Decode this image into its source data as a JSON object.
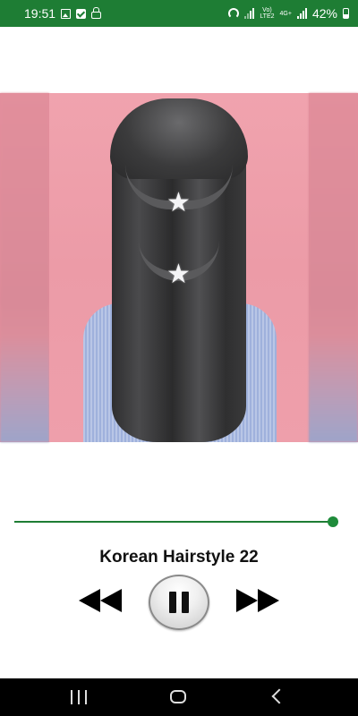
{
  "status_bar": {
    "time": "19:51",
    "left_icons": [
      "gallery-icon",
      "check-icon",
      "lock-icon"
    ],
    "right_icons": [
      "hotspot-icon",
      "signal-icon",
      "volte-icon",
      "signal-icon",
      "battery-icon"
    ],
    "volte_label_top": "Vo)",
    "volte_label_bottom": "LTE2",
    "network_label": "4G+",
    "battery": "42%"
  },
  "player": {
    "title": "Korean Hairstyle 22",
    "progress": 0.99,
    "colors": {
      "accent": "#1e7d34",
      "status_bar": "#1e7d34"
    }
  },
  "controls": {
    "rewind_icon": "rewind-icon",
    "pause_icon": "pause-icon",
    "fast_forward_icon": "fast-forward-icon"
  },
  "nav_bar": {
    "recent_icon": "recent-apps-icon",
    "home_icon": "home-icon",
    "back_icon": "back-icon"
  }
}
